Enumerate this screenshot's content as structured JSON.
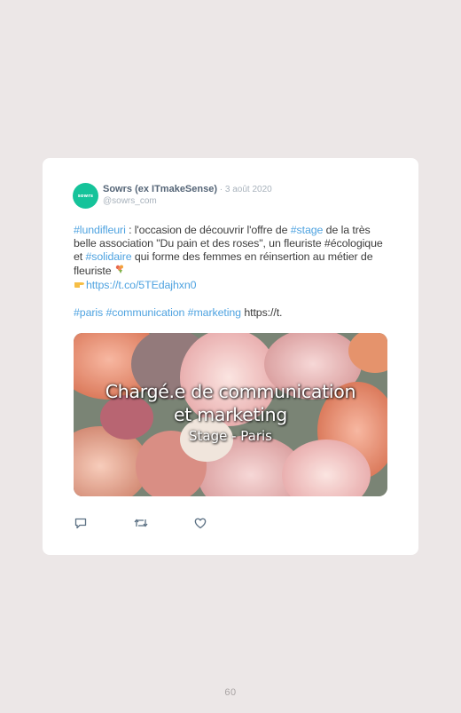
{
  "tweet": {
    "avatar_text": "sowrs",
    "author": "Sowrs (ex ITmakeSense)",
    "separator": " · ",
    "date": "3 août 2020",
    "handle": "@sowrs_com",
    "body": {
      "tag_lundifleuri": "#lundifleuri",
      "text_1": " : l'occasion de découvrir l'offre de ",
      "tag_stage": "#stage",
      "text_2": " de la très belle association \"Du pain et des roses\", un fleuriste #écologique et ",
      "tag_solidaire": "#solidaire",
      "text_3": " qui forme des femmes en réinsertion au métier de fleuriste ",
      "link": "https://t.co/5TEdajhxn0",
      "tag_paris": "#paris",
      "tag_communication": "#communication",
      "tag_marketing": "#marketing",
      "trailing_link": "https://t."
    },
    "media": {
      "title_line_1": "Chargé.e de communication",
      "title_line_2": "et marketing",
      "subtitle": "Stage - Paris"
    },
    "actions": {
      "reply_icon": "reply-icon",
      "retweet_icon": "retweet-icon",
      "like_icon": "heart-icon"
    },
    "colors": {
      "link": "#4fa3e0",
      "author": "#556577",
      "muted": "#a8b2bc",
      "avatar": "#15c39a"
    }
  },
  "page": {
    "number": "60",
    "background": "#ece7e7"
  }
}
